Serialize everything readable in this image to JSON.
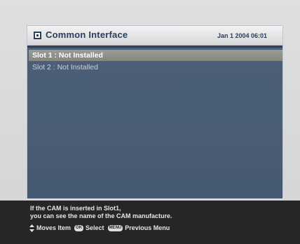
{
  "title": "Common Interface",
  "datetime": "Jan 1 2004 06:01",
  "slots": [
    {
      "label": "Slot 1 : Not Installed",
      "selected": true
    },
    {
      "label": "Slot 2 : Not Installed",
      "selected": false
    }
  ],
  "help": {
    "line1": "If the CAM is inserted in Slot1,",
    "line2": "you can see the name of the CAM manufacture."
  },
  "keys": {
    "moves_label": "Moves Item",
    "ok_key": "OK",
    "select_label": "Select",
    "menu_key": "MENU",
    "previous_label": "Previous Menu"
  },
  "icons": {
    "title": "window-icon",
    "navigate": "up-down-arrows-icon"
  },
  "colors": {
    "panel_content": "#4b5f77",
    "selection": "#939390",
    "title_text": "#2a3e5a",
    "footer": "#262626"
  }
}
